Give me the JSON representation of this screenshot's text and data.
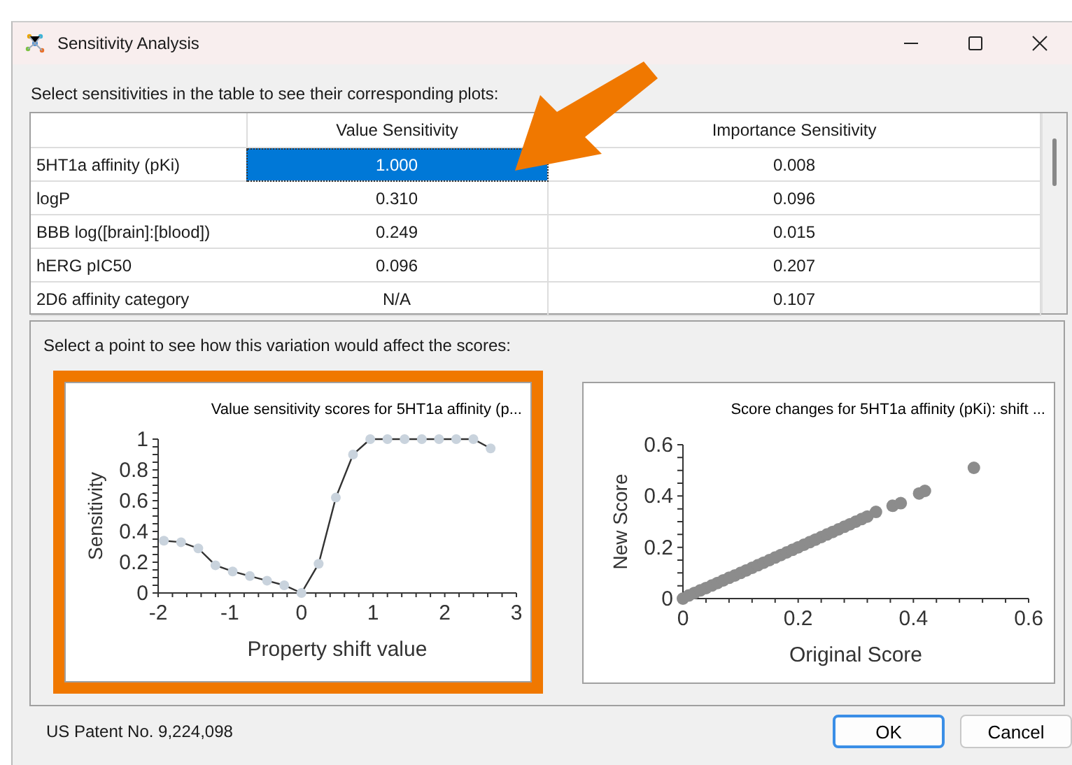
{
  "window": {
    "title": "Sensitivity Analysis"
  },
  "table_prompt": "Select sensitivities in the table to see their corresponding plots:",
  "table": {
    "columns": [
      "Value Sensitivity",
      "Importance Sensitivity"
    ],
    "rows": [
      {
        "property": "5HT1a affinity (pKi)",
        "cells": [
          {
            "text": "1.000",
            "selected": true
          },
          {
            "text": "0.008",
            "selected": false
          }
        ]
      },
      {
        "property": "logP",
        "cells": [
          {
            "text": "0.310",
            "selected": false
          },
          {
            "text": "0.096",
            "selected": false
          }
        ]
      },
      {
        "property": "BBB log([brain]:[blood])",
        "cells": [
          {
            "text": "0.249",
            "selected": false
          },
          {
            "text": "0.015",
            "selected": false
          }
        ]
      },
      {
        "property": "hERG pIC50",
        "cells": [
          {
            "text": "0.096",
            "selected": false
          },
          {
            "text": "0.207",
            "selected": false
          }
        ]
      },
      {
        "property": "2D6 affinity category",
        "cells": [
          {
            "text": "N/A",
            "selected": false
          },
          {
            "text": "0.107",
            "selected": false
          }
        ]
      }
    ]
  },
  "plot_prompt": "Select a point to see how this variation would affect the scores:",
  "plots": [
    {
      "highlighted": true,
      "chart_data": {
        "type": "line",
        "title": "Value sensitivity scores for 5HT1a affinity (p...",
        "xlabel": "Property shift value",
        "ylabel": "Sensitivity",
        "x": [
          -1.92,
          -1.68,
          -1.44,
          -1.2,
          -0.96,
          -0.72,
          -0.48,
          -0.24,
          0,
          0.24,
          0.48,
          0.72,
          0.96,
          1.2,
          1.44,
          1.68,
          1.92,
          2.16,
          2.4,
          2.64
        ],
        "series": [
          {
            "color": "#c9d3dd",
            "marker": "circle",
            "values": [
              0.34,
              0.33,
              0.29,
              0.18,
              0.14,
              0.11,
              0.08,
              0.05,
              0.0,
              0.19,
              0.62,
              0.9,
              1,
              1,
              1,
              1,
              1,
              1,
              1,
              0.94
            ]
          }
        ],
        "xlim": [
          -2,
          3
        ],
        "ylim": [
          0,
          1
        ],
        "xticks": [
          -2,
          -1,
          0,
          1,
          2,
          3
        ],
        "yticks": [
          0,
          0.2,
          0.4,
          0.6,
          0.8,
          1
        ]
      }
    },
    {
      "chart_data": {
        "type": "scatter",
        "title": "Score changes for 5HT1a affinity (pKi): shift ...",
        "xlabel": "Original Score",
        "ylabel": "New Score",
        "x": [
          0,
          0.01,
          0.02,
          0.03,
          0.04,
          0.05,
          0.06,
          0.07,
          0.08,
          0.09,
          0.1,
          0.11,
          0.12,
          0.13,
          0.14,
          0.15,
          0.16,
          0.17,
          0.18,
          0.19,
          0.2,
          0.21,
          0.22,
          0.23,
          0.24,
          0.25,
          0.26,
          0.27,
          0.28,
          0.29,
          0.3,
          0.31,
          0.32,
          0.335,
          0.364,
          0.378,
          0.41,
          0.42,
          0.505
        ],
        "series": [
          {
            "color": "#8c8c8c",
            "values": [
              0,
              0.012,
              0.022,
              0.032,
              0.041,
              0.051,
              0.061,
              0.071,
              0.081,
              0.09,
              0.1,
              0.11,
              0.12,
              0.13,
              0.14,
              0.15,
              0.16,
              0.17,
              0.18,
              0.19,
              0.2,
              0.21,
              0.22,
              0.23,
              0.24,
              0.25,
              0.26,
              0.27,
              0.28,
              0.29,
              0.3,
              0.31,
              0.32,
              0.338,
              0.362,
              0.372,
              0.41,
              0.42,
              0.51
            ]
          }
        ],
        "xlim": [
          0,
          0.6
        ],
        "ylim": [
          0,
          0.6
        ],
        "xticks": [
          0,
          0.2,
          0.4,
          0.6
        ],
        "yticks": [
          0,
          0.2,
          0.4,
          0.6
        ]
      }
    }
  ],
  "footer": {
    "patent": "US Patent No. 9,224,098",
    "buttons": [
      {
        "label": "OK",
        "default": true
      },
      {
        "label": "Cancel",
        "default": false
      }
    ]
  }
}
